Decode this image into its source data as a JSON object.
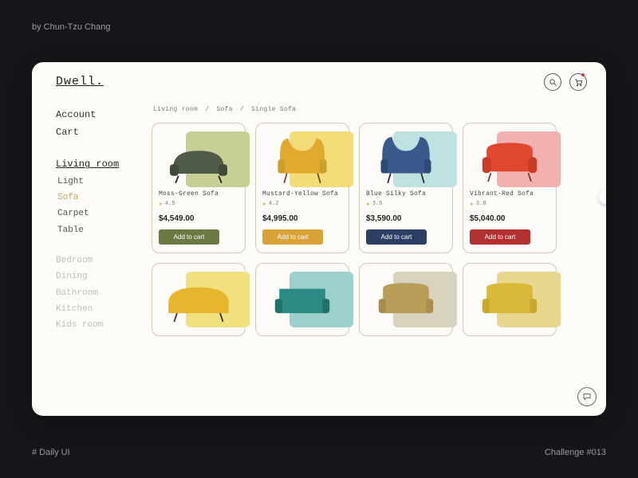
{
  "meta": {
    "attribution": "by Chun-Tzu Chang",
    "footer_left": "# Daily UI",
    "footer_right": "Challenge #013"
  },
  "brand": "Dwell.",
  "sidebar": {
    "account": "Account",
    "cart": "Cart",
    "active_room": "Living room",
    "subcats": [
      {
        "label": "Light",
        "active": false
      },
      {
        "label": "Sofa",
        "active": true
      },
      {
        "label": "Carpet",
        "active": false
      },
      {
        "label": "Table",
        "active": false
      }
    ],
    "rooms": [
      "Bedroom",
      "Dining",
      "Bathroom",
      "Kitchen",
      "Kids room"
    ]
  },
  "breadcrumb": [
    "Living room",
    "Sofa",
    "Single Sofa"
  ],
  "add_to_cart_label": "Add to cart",
  "products": [
    {
      "name": "Moss-Green Sofa",
      "rating": "4.5",
      "price": "$4,549.00",
      "accent": "#c8cf94",
      "btn": "#6b7a45"
    },
    {
      "name": "Mustard-Yellow Sofa",
      "rating": "4.2",
      "price": "$4,995.00",
      "accent": "#f3dd78",
      "btn": "#d9a236"
    },
    {
      "name": "Blue Silky Sofa",
      "rating": "3.5",
      "price": "$3,590.00",
      "accent": "#bfe2e0",
      "btn": "#2c3e63"
    },
    {
      "name": "Vibrant-Red Sofa",
      "rating": "3.8",
      "price": "$5,040.00",
      "accent": "#f2b1ae",
      "btn": "#b33030"
    }
  ],
  "row2_accents": [
    "#f1e07e",
    "#9dd0cc",
    "#d8d3bc",
    "#e8d88e"
  ],
  "icons": {
    "search": "search-icon",
    "cart": "cart-icon",
    "chat": "chat-icon"
  }
}
